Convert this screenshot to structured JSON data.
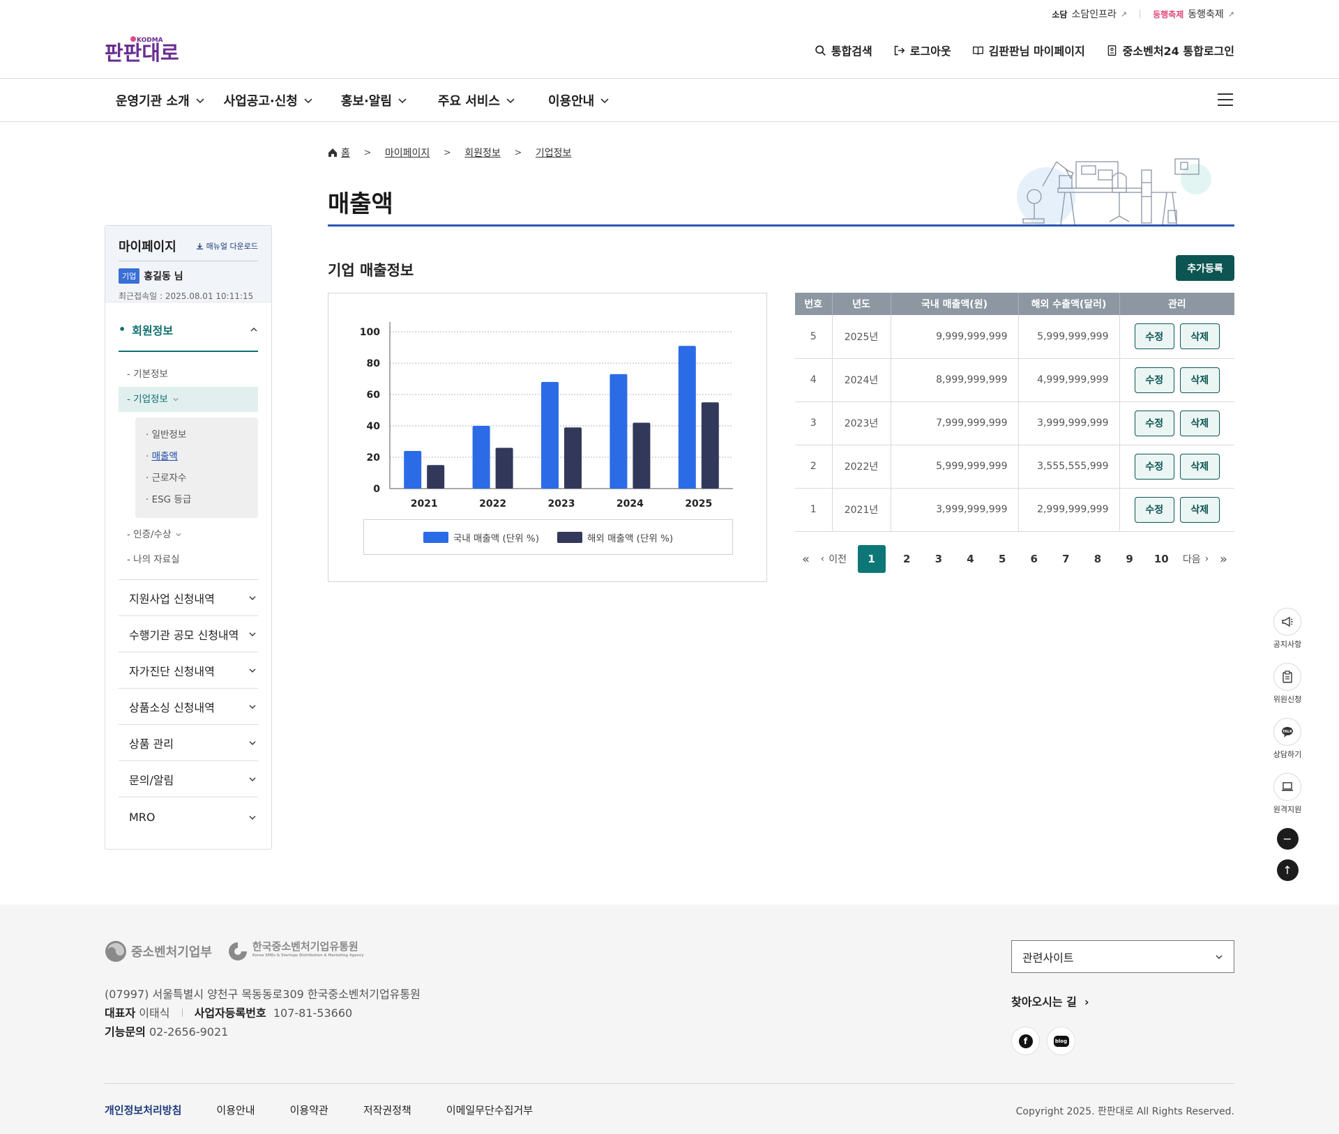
{
  "header": {
    "top_links": [
      {
        "mini": "소담",
        "label": "소담인프라",
        "ext": "↗"
      },
      {
        "mini": "동행축제",
        "label": "동행축제",
        "ext": "↗"
      }
    ],
    "logo_text": "판판대로",
    "logo_sub": "KODMA",
    "util": [
      "통합검색",
      "로그아웃",
      "김판판님 마이페이지",
      "중소벤처24 통합로그인"
    ],
    "gnb": [
      "운영기관 소개",
      "사업공고·신청",
      "홍보·알림",
      "주요 서비스",
      "이용안내"
    ]
  },
  "sidebar": {
    "title": "마이페이지",
    "manual": "매뉴얼 다운로드",
    "badge": "기업",
    "user": "홍길동 님",
    "last_login": "최근접속일 : 2025.08.01 10:11:15",
    "active_section": "회원정보",
    "sub_items": [
      "- 기본정보",
      "- 기업정보",
      "- 인증/수상",
      "- 나의 자료실"
    ],
    "subsub_items": [
      "· 일반정보",
      "매출액",
      "· 근로자수",
      "· ESG 등급"
    ],
    "subsub_bullet": "· ",
    "menu": [
      "지원사업 신청내역",
      "수행기관 공모 신청내역",
      "자가진단 신청내역",
      "상품소싱 신청내역",
      "상품 관리",
      "문의/알림",
      "MRO"
    ]
  },
  "breadcrumb": [
    "홈",
    "마이페이지",
    "회원정보",
    "기업정보"
  ],
  "page_title": "매출액",
  "section_title": "기업 매출정보",
  "add_button": "추가등록",
  "chart_data": {
    "type": "bar",
    "categories": [
      "2021",
      "2022",
      "2023",
      "2024",
      "2025"
    ],
    "series": [
      {
        "name": "국내 매출액 (단위 %)",
        "color": "#2b6be6",
        "values": [
          24,
          40,
          68,
          73,
          91
        ]
      },
      {
        "name": "해외 매출액 (단위 %)",
        "color": "#32385a",
        "values": [
          15,
          26,
          39,
          42,
          55
        ]
      }
    ],
    "yticks": [
      "100",
      "80",
      "60",
      "40",
      "20",
      "0"
    ],
    "ylim": [
      0,
      100
    ],
    "grid": true,
    "legend": "bottom"
  },
  "table": {
    "headers": [
      "번호",
      "년도",
      "국내 매출액(원)",
      "해외 수출액(달러)",
      "관리"
    ],
    "edit_label": "수정",
    "delete_label": "삭제",
    "rows": [
      {
        "no": "5",
        "year": "2025년",
        "domestic": "9,999,999,999",
        "overseas": "5,999,999,999"
      },
      {
        "no": "4",
        "year": "2024년",
        "domestic": "8,999,999,999",
        "overseas": "4,999,999,999"
      },
      {
        "no": "3",
        "year": "2023년",
        "domestic": "7,999,999,999",
        "overseas": "3,999,999,999"
      },
      {
        "no": "2",
        "year": "2022년",
        "domestic": "5,999,999,999",
        "overseas": "3,555,555,999"
      },
      {
        "no": "1",
        "year": "2021년",
        "domestic": "3,999,999,999",
        "overseas": "2,999,999,999"
      }
    ]
  },
  "pagination": {
    "first": "«",
    "prev": "이전",
    "next": "다음",
    "last": "»",
    "pages": [
      "1",
      "2",
      "3",
      "4",
      "5",
      "6",
      "7",
      "8",
      "9",
      "10"
    ],
    "current": "1"
  },
  "quick_menu": [
    "공지사항",
    "위원신청",
    "상담하기",
    "원격지원"
  ],
  "quick_icons": {
    "minus": "−",
    "top": "↑"
  },
  "footer": {
    "logo1": "중소벤처기업부",
    "logo2": "한국중소벤처기업유통원",
    "logo2_sub": "Korea SMEs & Startups Distribution & Marketing Agency",
    "address": "(07997) 서울특별시 양천구 목동동로309 한국중소벤처기업유통원",
    "ceo_label": "대표자",
    "ceo": "이태식",
    "biz_label": "사업자등록번호",
    "biz_no": "107-81-53660",
    "contact_label": "기능문의",
    "contact": "02-2656-9021",
    "related": "관련사이트",
    "directions": "찾아오시는 길",
    "sns": [
      "f",
      "blog"
    ],
    "links": [
      "개인정보처리방침",
      "이용안내",
      "이용약관",
      "저작권정책",
      "이메일무단수집거부"
    ],
    "copyright": "Copyright 2025. 판판대로 All Rights Reserved."
  }
}
